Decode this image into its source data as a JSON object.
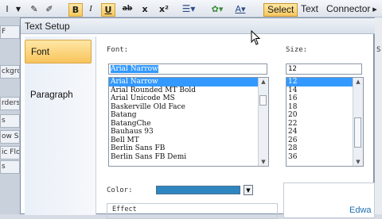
{
  "toolbar": {
    "bold": "B",
    "italic": "I",
    "underline": "U",
    "strike": "ab",
    "x": "x",
    "sup": "x²",
    "select": "Select",
    "text": "Text",
    "connector": "Connector"
  },
  "background_strip": [
    "F",
    "",
    "ckgro",
    "rders",
    "s",
    "ow Sh",
    "ic Flo",
    "s"
  ],
  "dialog": {
    "title": "Text Setup",
    "sidebar": [
      "Font",
      "Paragraph"
    ],
    "font_label": "Font:",
    "size_label": "Size:",
    "font_value": "Arial Narrow",
    "size_value": "12",
    "fonts": [
      "Arial Narrow",
      "Arial Rounded MT Bold",
      "Arial Unicode MS",
      "Baskerville Old Face",
      "Batang",
      "BatangChe",
      "Bauhaus 93",
      "Bell MT",
      "Berlin Sans FB",
      "Berlin Sans FB Demi"
    ],
    "sizes": [
      "12",
      "14",
      "16",
      "18",
      "20",
      "22",
      "24",
      "26",
      "28",
      "36"
    ],
    "color_label": "Color:",
    "color_value": "#2e86c1",
    "effect_label": "Effect",
    "preview_text": "Edwa"
  }
}
